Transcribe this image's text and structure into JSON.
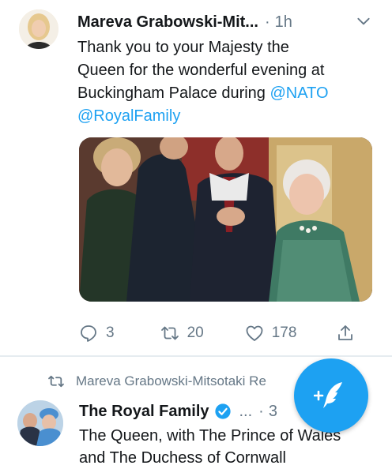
{
  "tweet1": {
    "author": "Mareva Grabowski-Mit...",
    "time": "1h",
    "text_line1": "Thank you to your Majesty the",
    "text_line2": "Queen for the wonderful evening at",
    "text_line3": "Buckingham Palace during ",
    "mention_nato": "@NATO",
    "mention_royal": "@RoyalFamily",
    "replies": "3",
    "retweets": "20",
    "likes": "178"
  },
  "tweet2": {
    "retweeted_by": "Mareva Grabowski-Mitsotaki Re",
    "author": "The Royal Family",
    "ellipsis": "...",
    "time": "3",
    "text_line1": "The Queen, with The Prince of Wales",
    "text_line2": "and The Duchess of Cornwall"
  },
  "colors": {
    "accent": "#1da1f2",
    "muted": "#657786",
    "divider": "#e6ecf0"
  },
  "icons": [
    "chevron-down-icon",
    "reply-icon",
    "retweet-icon",
    "like-icon",
    "share-icon",
    "verified-icon",
    "compose-icon"
  ]
}
